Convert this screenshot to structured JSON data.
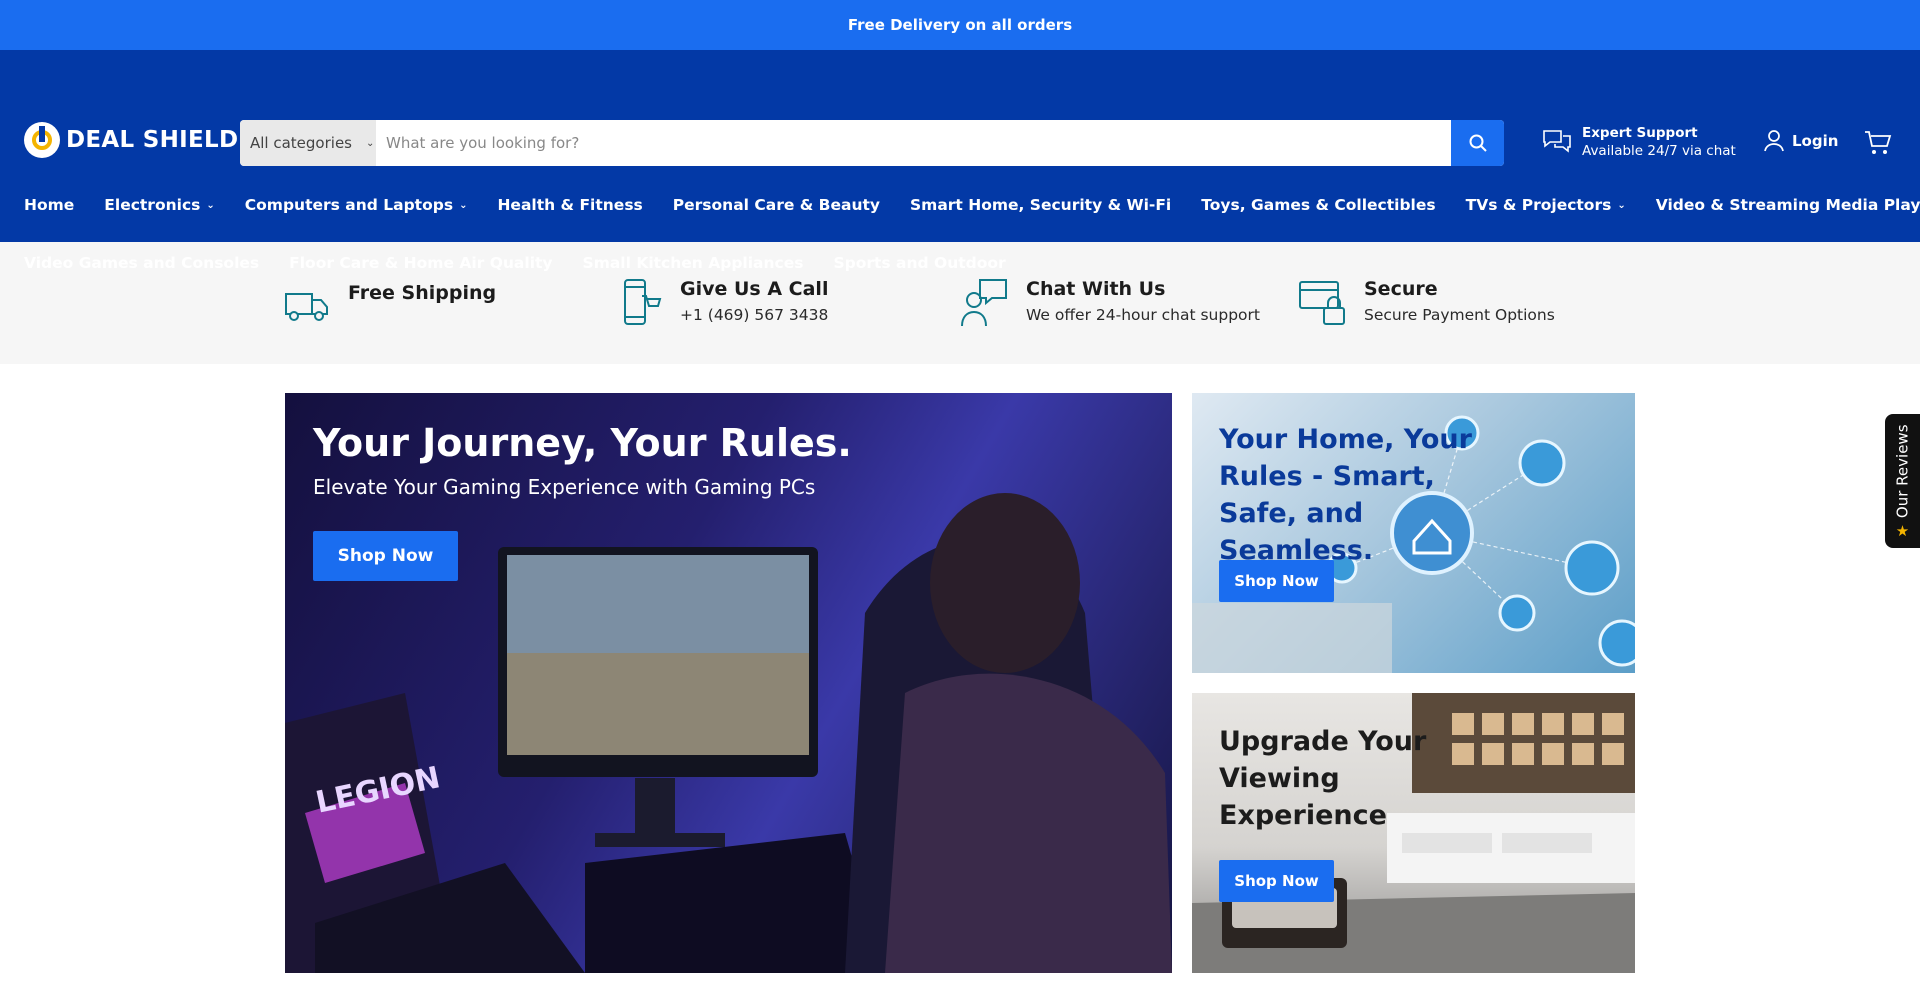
{
  "announcement": "Free Delivery on all orders",
  "header": {
    "logo_text": "DEAL SHIELD",
    "search": {
      "category": "All categories",
      "placeholder": "What are you looking for?"
    },
    "support": {
      "title": "Expert Support",
      "subtitle": "Available 24/7 via chat"
    },
    "login_label": "Login"
  },
  "nav": {
    "row1": [
      {
        "label": "Home",
        "dropdown": false
      },
      {
        "label": "Electronics",
        "dropdown": true
      },
      {
        "label": "Computers and Laptops",
        "dropdown": true
      },
      {
        "label": "Health & Fitness",
        "dropdown": false
      },
      {
        "label": "Personal Care & Beauty",
        "dropdown": false
      },
      {
        "label": "Smart Home, Security & Wi-Fi",
        "dropdown": false
      },
      {
        "label": "Toys, Games & Collectibles",
        "dropdown": false
      },
      {
        "label": "TVs & Projectors",
        "dropdown": true
      },
      {
        "label": "Video & Streaming Media Players",
        "dropdown": true
      }
    ],
    "row2": [
      {
        "label": "Video Games and Consoles"
      },
      {
        "label": "Floor Care & Home Air Quality"
      },
      {
        "label": "Small Kitchen Appliances"
      },
      {
        "label": "Sports and Outdoor"
      }
    ]
  },
  "features": [
    {
      "title": "Free Shipping",
      "subtitle": "",
      "icon": "truck-icon"
    },
    {
      "title": "Give Us A Call",
      "subtitle": "+1 (469) 567 3438",
      "icon": "phone-cart-icon"
    },
    {
      "title": "Chat With Us",
      "subtitle": "We offer 24-hour chat support",
      "icon": "chat-person-icon"
    },
    {
      "title": "Secure",
      "subtitle": "Secure Payment Options",
      "icon": "lock-card-icon"
    }
  ],
  "hero": {
    "title": "Your Journey, Your Rules.",
    "subtitle": "Elevate Your Gaming Experience with Gaming PCs",
    "button": "Shop Now",
    "laptop_brand": "LEGION"
  },
  "side_banners": [
    {
      "title": "Your Home, Your Rules - Smart, Safe, and Seamless.",
      "button": "Shop Now"
    },
    {
      "title": "Upgrade Your Viewing Experience",
      "button": "Shop Now"
    }
  ],
  "reviews_tab": "Our Reviews",
  "colors": {
    "brand_blue": "#0339a6",
    "accent_blue": "#1a6df0",
    "star": "#f4b400"
  }
}
